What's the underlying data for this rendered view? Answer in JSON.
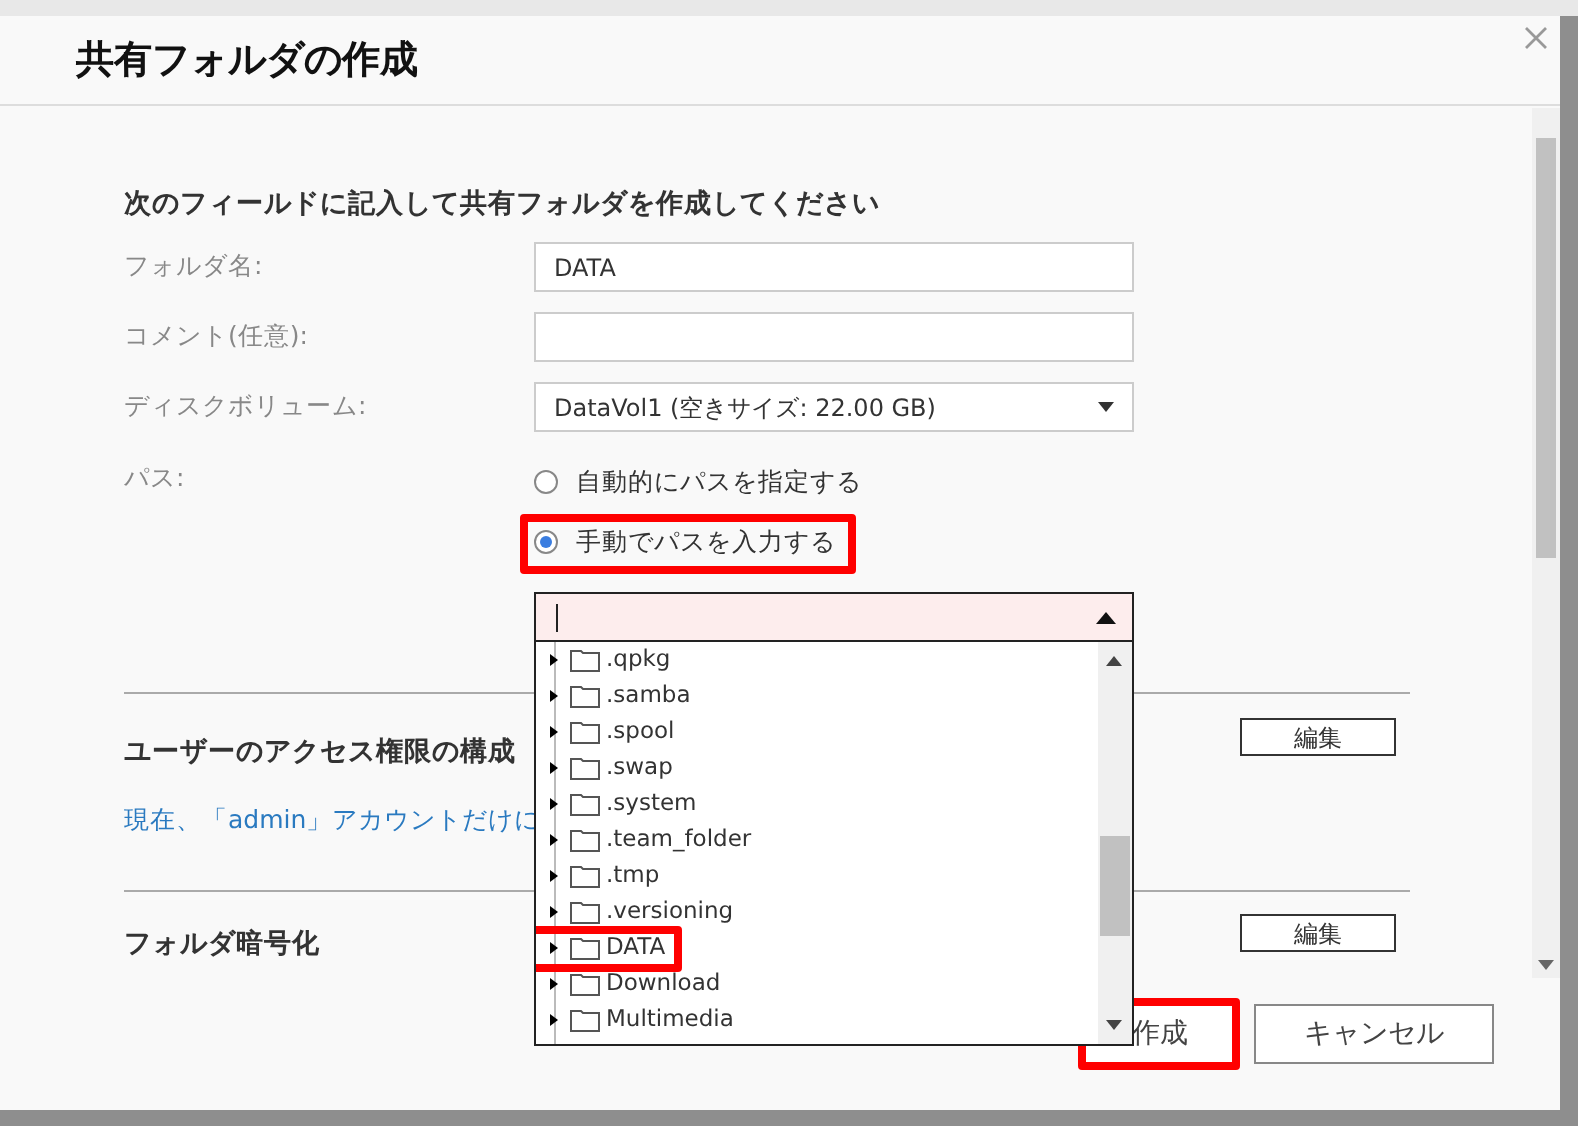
{
  "dialog": {
    "title": "共有フォルダの作成"
  },
  "form": {
    "heading": "次のフィールドに記入して共有フォルダを作成してください",
    "fields": [
      {
        "kind": "text",
        "label": "フォルダ名:",
        "value": "DATA"
      },
      {
        "kind": "text",
        "label": "コメント(任意):"
      },
      {
        "kind": "select",
        "label": "ディスクボリューム:",
        "value": "DataVol1 (空きサイズ: 22.00 GB)"
      },
      {
        "kind": "radio",
        "label": "パス:",
        "options": [
          {
            "label": "自動的にパスを指定する",
            "selected": false,
            "highlighted": false
          },
          {
            "label": "手動でパスを入力する",
            "selected": true,
            "highlighted": true
          }
        ]
      }
    ]
  },
  "path_picker": {
    "expanded": true,
    "folders": [
      {
        "label": ".qpkg",
        "highlighted": false
      },
      {
        "label": ".samba",
        "highlighted": false
      },
      {
        "label": ".spool",
        "highlighted": false
      },
      {
        "label": ".swap",
        "highlighted": false
      },
      {
        "label": ".system",
        "highlighted": false
      },
      {
        "label": ".team_folder",
        "highlighted": false
      },
      {
        "label": ".tmp",
        "highlighted": false
      },
      {
        "label": ".versioning",
        "highlighted": false
      },
      {
        "label": "DATA",
        "highlighted": true
      },
      {
        "label": "Download",
        "highlighted": false
      },
      {
        "label": "Multimedia",
        "highlighted": false
      }
    ]
  },
  "sections": [
    {
      "title": "ユーザーのアクセス権限の構成",
      "button": "編集",
      "note": "現在、「admin」アカウントだけに"
    },
    {
      "title": "フォルダ暗号化",
      "button": "編集"
    }
  ],
  "buttons": [
    {
      "label": "作成",
      "highlighted": true
    },
    {
      "label": "キャンセル",
      "highlighted": false
    }
  ]
}
